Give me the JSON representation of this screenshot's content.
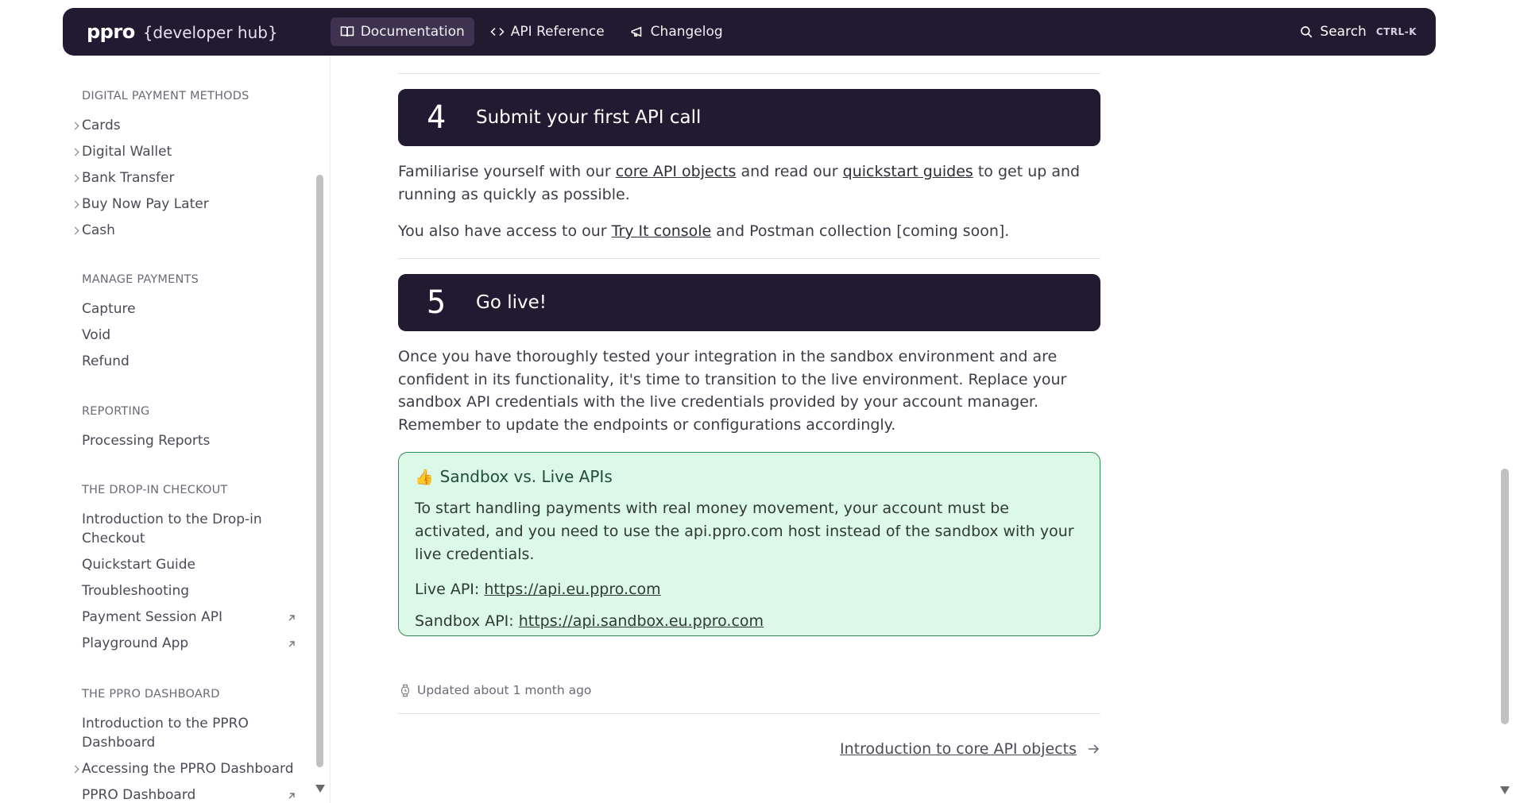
{
  "header": {
    "logo_mark": "ppro",
    "logo_text": "{developer hub}",
    "tabs": [
      {
        "label": "Documentation",
        "icon": "book-icon"
      },
      {
        "label": "API Reference",
        "icon": "code-brackets-icon"
      },
      {
        "label": "Changelog",
        "icon": "megaphone-icon"
      }
    ],
    "search_label": "Search",
    "search_shortcut": "CTRL-K"
  },
  "sidebar": {
    "sections": [
      {
        "title": "DIGITAL PAYMENT METHODS",
        "items": [
          "Cards",
          "Digital Wallet",
          "Bank Transfer",
          "Buy Now Pay Later",
          "Cash"
        ]
      },
      {
        "title": "MANAGE PAYMENTS",
        "items": [
          "Capture",
          "Void",
          "Refund"
        ]
      },
      {
        "title": "REPORTING",
        "items": [
          "Processing Reports"
        ]
      },
      {
        "title": "THE DROP-IN CHECKOUT",
        "items": [
          "Introduction to the Drop-in Checkout",
          "Quickstart Guide",
          "Troubleshooting",
          "Payment Session API",
          "Playground App"
        ]
      },
      {
        "title": "THE PPRO DASHBOARD",
        "items": [
          "Introduction to the PPRO Dashboard",
          "Accessing the PPRO Dashboard",
          "PPRO Dashboard"
        ]
      }
    ]
  },
  "main": {
    "step4": {
      "number": "4",
      "title": "Submit your first API call",
      "p1_a": "Familiarise yourself with our ",
      "p1_link1": "core API objects",
      "p1_b": " and read our ",
      "p1_link2": "quickstart guides",
      "p1_c": " to get up and running as quickly as possible.",
      "p2_a": "You also have access to our ",
      "p2_link": "Try It console",
      "p2_b": " and Postman collection [coming soon]."
    },
    "step5": {
      "number": "5",
      "title": "Go live!",
      "p1": "Once you have thoroughly tested your integration in the sandbox environment and are confident in its functionality, it's time to transition to the live environment. Replace your sandbox API credentials with the live credentials provided by your account manager. Remember to update the endpoints or configurations accordingly."
    },
    "callout": {
      "emoji": "👍",
      "title": "Sandbox vs. Live APIs",
      "body": "To start handling payments with real money movement, your account must be activated, and you need to use the api.ppro.com host instead of the sandbox with your live credentials.",
      "live_label": "Live API: ",
      "live_url": "https://api.eu.ppro.com",
      "sandbox_label": "Sandbox API: ",
      "sandbox_url": "https://api.sandbox.eu.ppro.com"
    },
    "updated": "Updated about 1 month ago",
    "next_link": "Introduction to core API objects"
  }
}
